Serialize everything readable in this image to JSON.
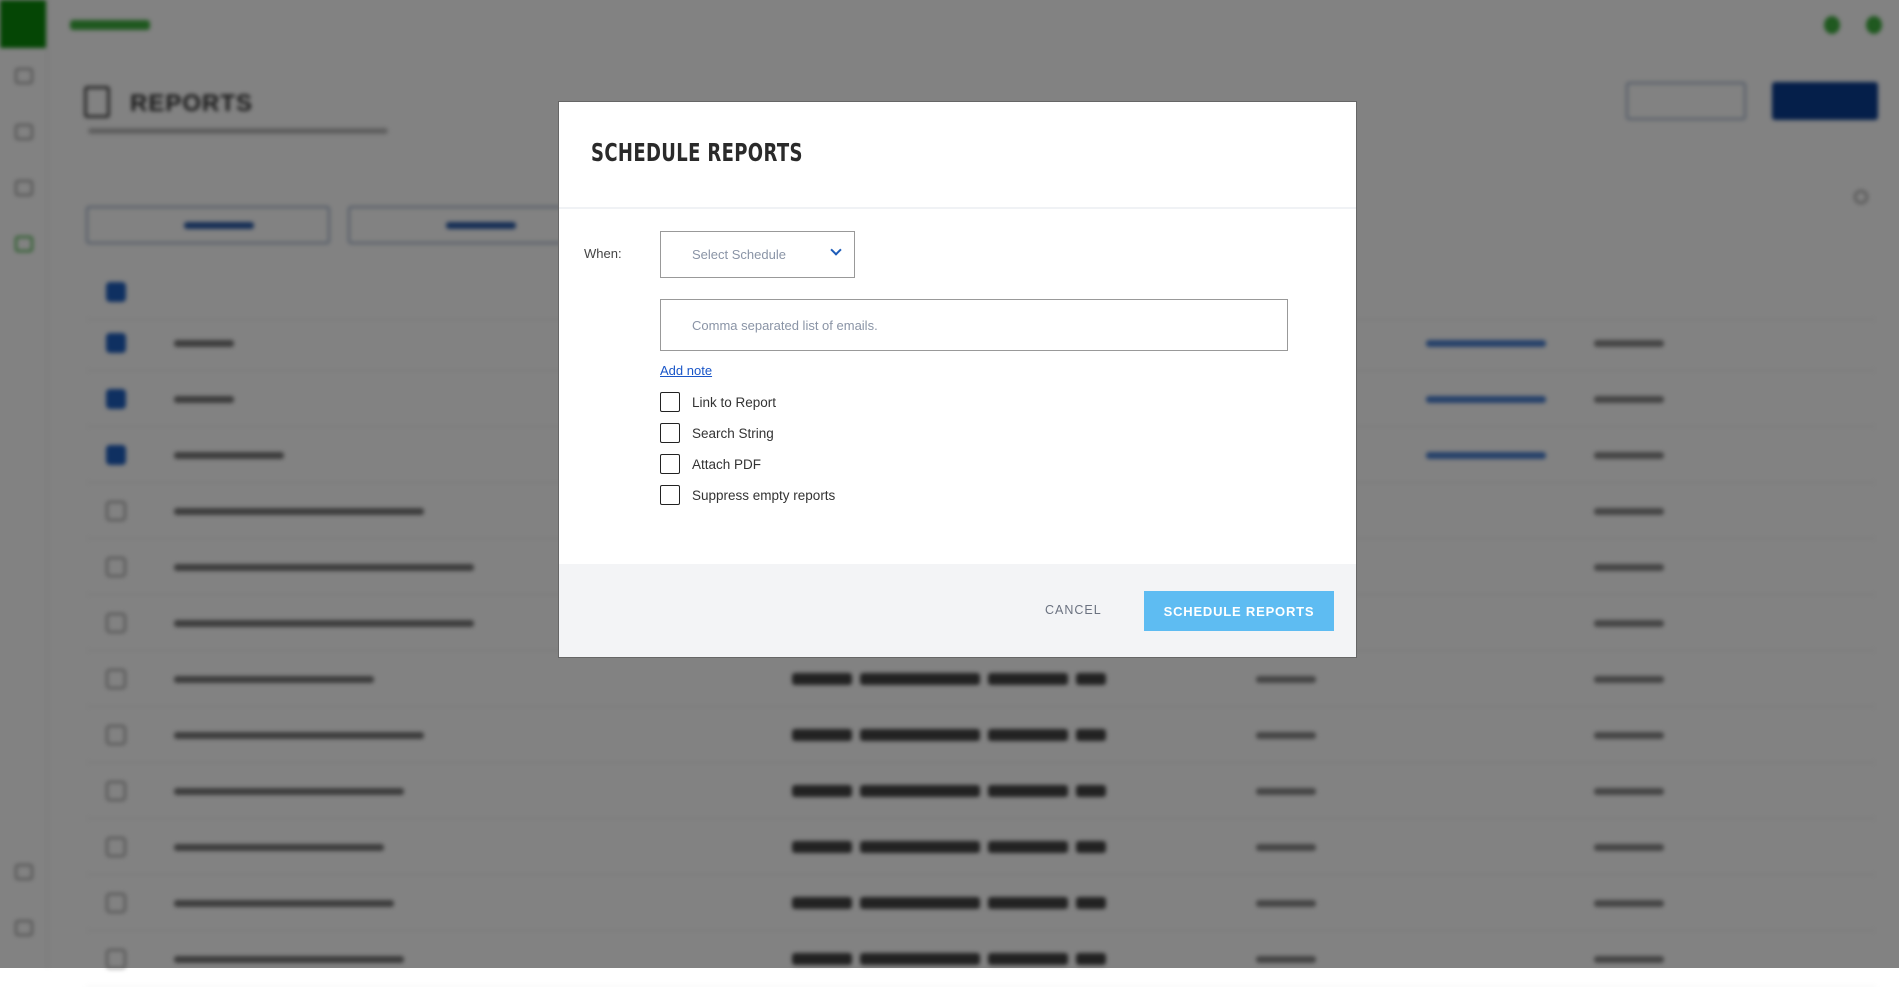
{
  "background": {
    "page_title": "REPORTS",
    "selected_rows": 3,
    "row_count": 12
  },
  "modal": {
    "title": "SCHEDULE REPORTS",
    "when_label": "When:",
    "schedule_select": {
      "placeholder": "Select Schedule"
    },
    "emails_input": {
      "value": "",
      "placeholder": "Comma separated list of emails."
    },
    "add_note_link": "Add note",
    "options": [
      {
        "label": "Link to Report",
        "checked": false
      },
      {
        "label": "Search String",
        "checked": false
      },
      {
        "label": "Attach PDF",
        "checked": false
      },
      {
        "label": "Suppress empty reports",
        "checked": false
      }
    ],
    "cancel_label": "CANCEL",
    "submit_label": "SCHEDULE REPORTS"
  },
  "colors": {
    "primary_button": "#5ebcf2",
    "link": "#1a56c8",
    "brand": "#0a8a0a",
    "footer_bg": "#f3f4f6"
  }
}
